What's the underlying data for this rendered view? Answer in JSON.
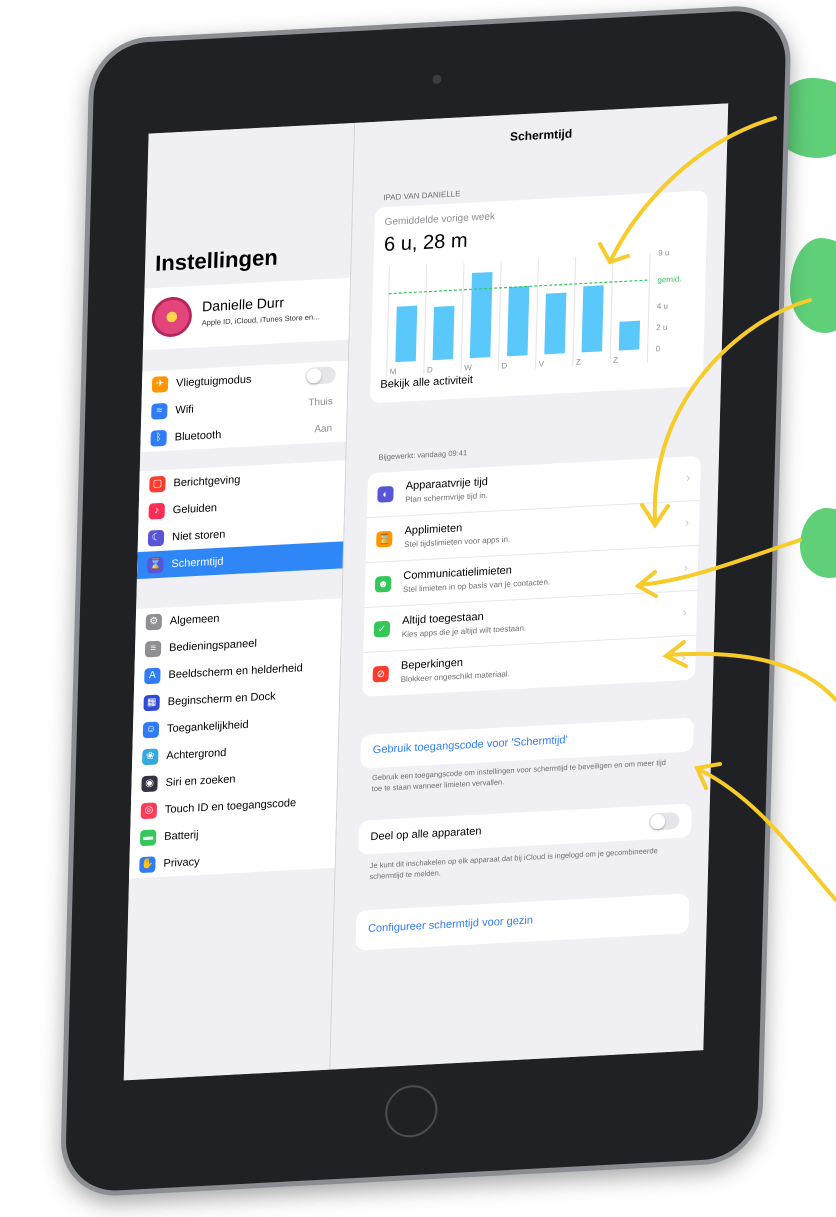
{
  "sidebar": {
    "title": "Instellingen",
    "profile": {
      "name": "Danielle Durr",
      "subtitle": "Apple ID, iCloud, iTunes Store en..."
    },
    "group1": [
      {
        "label": "Vliegtuigmodus",
        "value": "",
        "toggle": true,
        "icon": "airplane-icon",
        "color": "#ff9500"
      },
      {
        "label": "Wifi",
        "value": "Thuis",
        "icon": "wifi-icon",
        "color": "#2f7cf6"
      },
      {
        "label": "Bluetooth",
        "value": "Aan",
        "icon": "bluetooth-icon",
        "color": "#2f7cf6"
      }
    ],
    "group2": [
      {
        "label": "Berichtgeving",
        "icon": "notifications-icon",
        "color": "#ff3b30"
      },
      {
        "label": "Geluiden",
        "icon": "sounds-icon",
        "color": "#ff2d55"
      },
      {
        "label": "Niet storen",
        "icon": "moon-icon",
        "color": "#5856d6"
      },
      {
        "label": "Schermtijd",
        "icon": "hourglass-icon",
        "color": "#5856d6",
        "selected": true
      }
    ],
    "group3": [
      {
        "label": "Algemeen",
        "icon": "gear-icon",
        "color": "#8e8e93"
      },
      {
        "label": "Bedieningspaneel",
        "icon": "control-center-icon",
        "color": "#8e8e93"
      },
      {
        "label": "Beeldscherm en helderheid",
        "icon": "display-icon",
        "color": "#2f7cf6"
      },
      {
        "label": "Beginscherm en Dock",
        "icon": "home-screen-icon",
        "color": "#2f4bd6"
      },
      {
        "label": "Toegankelijkheid",
        "icon": "accessibility-icon",
        "color": "#2f7cf6"
      },
      {
        "label": "Achtergrond",
        "icon": "wallpaper-icon",
        "color": "#34aadc"
      },
      {
        "label": "Siri en zoeken",
        "icon": "siri-icon",
        "color": "#333344"
      },
      {
        "label": "Touch ID en toegangscode",
        "icon": "fingerprint-icon",
        "color": "#ff3b58"
      },
      {
        "label": "Batterij",
        "icon": "battery-icon",
        "color": "#34c759"
      },
      {
        "label": "Privacy",
        "icon": "hand-icon",
        "color": "#2f7cf6"
      }
    ]
  },
  "main": {
    "nav_title": "Schermtijd",
    "device_header": "IPAD VAN DANIELLE",
    "avg_label": "Gemiddelde vorige week",
    "avg_value": "6 u, 28 m",
    "see_all": "Bekijk alle activiteit",
    "updated": "Bijgewerkt: vandaag 09:41",
    "options": [
      {
        "title": "Apparaatvrije tijd",
        "sub": "Plan schermvrije tijd in.",
        "icon": "downtime-icon",
        "color": "#5856d6"
      },
      {
        "title": "Applimieten",
        "sub": "Stel tijdslimieten voor apps in.",
        "icon": "hourglass-icon",
        "color": "#ff9500"
      },
      {
        "title": "Communicatielimieten",
        "sub": "Stel limieten in op basis van je contacten.",
        "icon": "contacts-icon",
        "color": "#34c759"
      },
      {
        "title": "Altijd toegestaan",
        "sub": "Kies apps die je altijd wilt toestaan.",
        "icon": "checkmark-icon",
        "color": "#34c759"
      },
      {
        "title": "Beperkingen",
        "sub": "Blokkeer ongeschikt materiaal.",
        "icon": "restriction-icon",
        "color": "#ff3b30"
      }
    ],
    "passcode_link": "Gebruik toegangscode voor 'Schermtijd'",
    "passcode_foot": "Gebruik een toegangscode om instellingen voor schermtijd te beveiligen en om meer tijd toe te staan wanneer limieten vervallen.",
    "share_label": "Deel op alle apparaten",
    "share_foot": "Je kunt dit inschakelen op elk apparaat dat bij iCloud is ingelogd om je gecombineerde schermtijd te melden.",
    "family_link": "Configureer schermtijd voor gezin"
  },
  "chart_data": {
    "type": "bar",
    "categories": [
      "M",
      "D",
      "W",
      "D",
      "V",
      "Z",
      "Z"
    ],
    "values": [
      5.2,
      5.0,
      8.0,
      6.5,
      5.7,
      6.2,
      2.7
    ],
    "ylim": [
      0,
      9
    ],
    "yticks": [
      "9 u",
      "gemid.",
      "4 u",
      "2 u",
      "0"
    ],
    "average": 6.47,
    "bar_color": "#5ac8fa",
    "average_color": "#34c759"
  }
}
